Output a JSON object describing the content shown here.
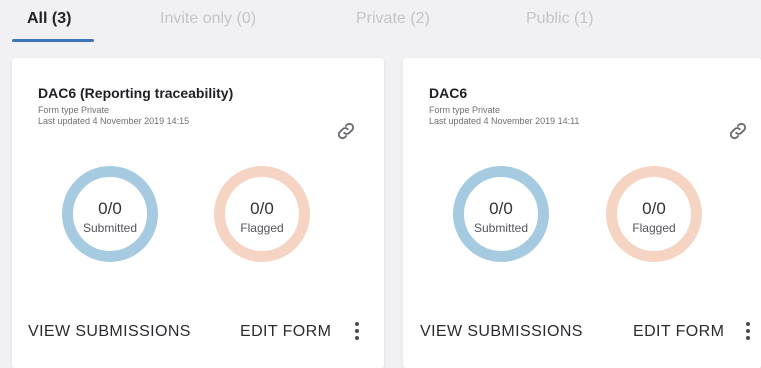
{
  "tabs": [
    {
      "label": "All (3)",
      "active": true
    },
    {
      "label": "Invite only (0)",
      "active": false
    },
    {
      "label": "Private (2)",
      "active": false
    },
    {
      "label": "Public (1)",
      "active": false
    }
  ],
  "cards": [
    {
      "title": "DAC6 (Reporting traceability)",
      "form_type": "Form type Private",
      "last_updated": "Last updated 4 November 2019 14:15",
      "submitted": {
        "value": "0/0",
        "label": "Submitted"
      },
      "flagged": {
        "value": "0/0",
        "label": "Flagged"
      },
      "view_label": "VIEW SUBMISSIONS",
      "edit_label": "EDIT FORM"
    },
    {
      "title": "DAC6",
      "form_type": "Form type Private",
      "last_updated": "Last updated 4 November 2019 14:11",
      "submitted": {
        "value": "0/0",
        "label": "Submitted"
      },
      "flagged": {
        "value": "0/0",
        "label": "Flagged"
      },
      "view_label": "VIEW SUBMISSIONS",
      "edit_label": "EDIT FORM"
    }
  ],
  "colors": {
    "accent": "#3c76b8",
    "submitted_ring": "#a6cbe0",
    "flagged_ring": "#f6d4c4",
    "background": "#f1f1f3",
    "card": "#ffffff"
  },
  "icons": {
    "card_link": "link-icon",
    "card_menu": "kebab-menu-icon"
  }
}
